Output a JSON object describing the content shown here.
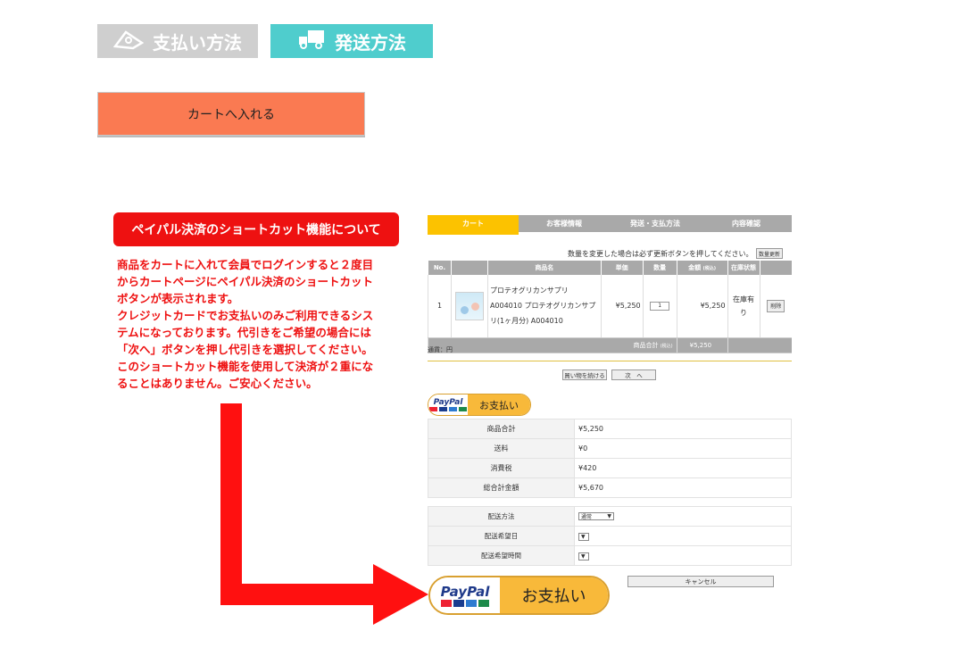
{
  "tabs": {
    "payment_label": "支払い方法",
    "shipping_label": "発送方法"
  },
  "cart_button_label": "カートへ入れる",
  "callout": {
    "title": "ペイパル決済のショートカット機能について",
    "lines": [
      "商品をカートに入れて会員でログインすると２度目",
      "からカートページにペイパル決済のショートカット",
      "ボタンが表示されます。",
      "クレジットカードでお支払いのみご利用できるシス",
      "テムになっております。代引きをご希望の場合には",
      "「次へ」ボタンを押し代引きを選択してください。",
      "このショートカット機能を使用して決済が２重にな",
      "ることはありません。ご安心ください。"
    ]
  },
  "steps": [
    "カート",
    "お客様情報",
    "発送・支払方法",
    "内容確認"
  ],
  "notice": "数量を変更した場合は必ず更新ボタンを押してください。",
  "update_button": "数量更新",
  "cart_table": {
    "headers": [
      "No.",
      "",
      "商品名",
      "単価",
      "数量",
      "金額",
      "在庫状態",
      ""
    ],
    "amount_header_note": "(税込)",
    "row": {
      "no": "1",
      "product_name": "プロテオグリカンサプリ A004010 プロテオグリカンサプリ(1ヶ月分) A004010",
      "unit_price": "¥5,250",
      "quantity": "1",
      "amount": "¥5,250",
      "stock": "在庫有り",
      "delete": "削除"
    },
    "total_label": "商品合計",
    "total_note": "(税込)",
    "total_value": "¥5,250"
  },
  "currency": "通貨：円",
  "continue_button": "買い物を続ける",
  "next_button": "次　へ",
  "paypal": {
    "brand": "PayPal",
    "pay_label": "お支払い"
  },
  "summary": [
    {
      "label": "商品合計",
      "value": "¥5,250"
    },
    {
      "label": "送料",
      "value": "¥0"
    },
    {
      "label": "消費税",
      "value": "¥420"
    },
    {
      "label": "総合計金額",
      "value": "¥5,670"
    }
  ],
  "delivery": [
    {
      "label": "配送方法",
      "value": "通常"
    },
    {
      "label": "配送希望日",
      "value": ""
    },
    {
      "label": "配送希望時間",
      "value": ""
    }
  ],
  "cancel_button": "キャンセル",
  "colors": {
    "tab_payment": "#cfcfcf",
    "tab_shipping": "#4fcdcd",
    "cart_button": "#fa7a52",
    "alert_red": "#ee1111",
    "step_active": "#fcc200",
    "paypal_gold": "#f8b93a"
  }
}
